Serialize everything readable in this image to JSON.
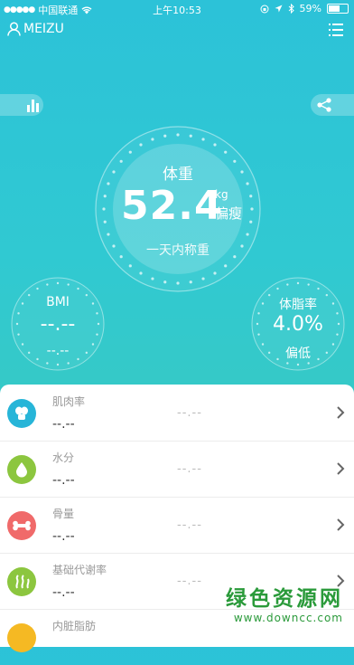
{
  "status": {
    "carrier": "中国联通",
    "time": "上午10:53",
    "battery": "59%",
    "battery_level": 0.59
  },
  "header": {
    "username": "MEIZU"
  },
  "weight": {
    "title": "体重",
    "value": "52.4",
    "unit": "kg",
    "status": "偏瘦",
    "note": "一天内称重"
  },
  "bmi": {
    "title": "BMI",
    "value": "--.--",
    "sub": "--.--"
  },
  "body_fat": {
    "title": "体脂率",
    "value": "4.0%",
    "status": "偏低"
  },
  "metrics": [
    {
      "label": "肌肉率",
      "value": "--.--",
      "mid": "--.--",
      "icon": "muscle-icon",
      "color": "#27b5d8"
    },
    {
      "label": "水分",
      "value": "--.--",
      "mid": "--.--",
      "icon": "water-icon",
      "color": "#8cc63f"
    },
    {
      "label": "骨量",
      "value": "--.--",
      "mid": "--.--",
      "icon": "bone-icon",
      "color": "#f06a6a"
    },
    {
      "label": "基础代谢率",
      "value": "--.--",
      "mid": "--.--",
      "icon": "metabolism-icon",
      "color": "#8cc63f"
    },
    {
      "label": "内脏脂肪",
      "value": "",
      "mid": "",
      "icon": "visceral-fat-icon",
      "color": "#f5b923"
    }
  ],
  "watermark": {
    "title": "绿色资源网",
    "url": "www.downcc.com"
  }
}
